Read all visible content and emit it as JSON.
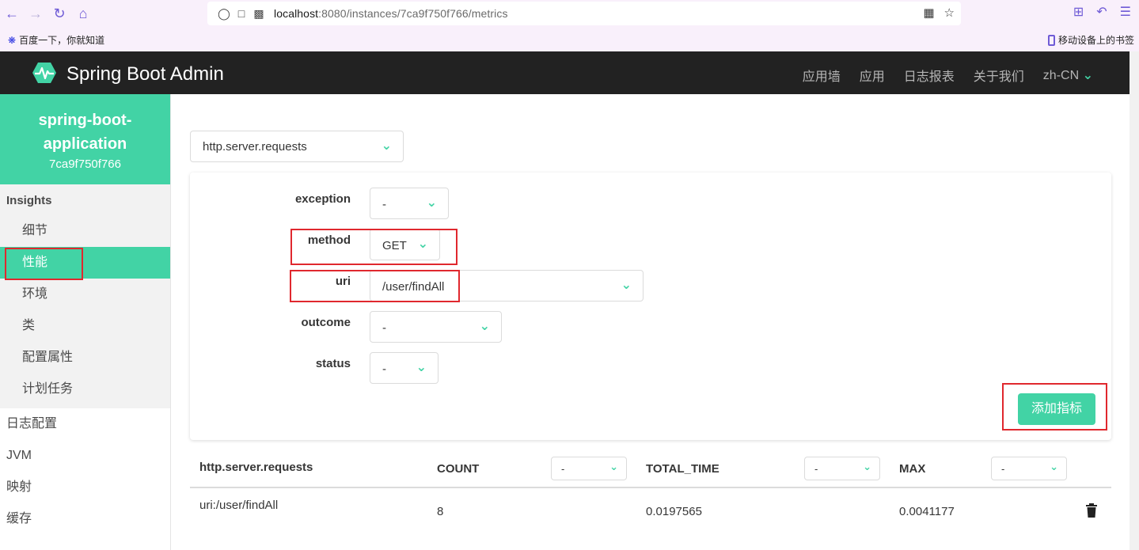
{
  "browser": {
    "url_host": "localhost",
    "url_rest": ":8080/instances/7ca9f750f766/metrics"
  },
  "bookmarks": {
    "left": "百度一下，你就知道",
    "right": "移动设备上的书签"
  },
  "header": {
    "brand": "Spring Boot Admin",
    "nav": [
      "应用墙",
      "应用",
      "日志报表",
      "关于我们"
    ],
    "lang": "zh-CN"
  },
  "sidebar": {
    "instance_name": "spring-boot-application",
    "instance_id": "7ca9f750f766",
    "group_title": "Insights",
    "group_items": [
      "细节",
      "性能",
      "环境",
      "类",
      "配置属性",
      "计划任务"
    ],
    "items": [
      "日志配置",
      "JVM",
      "映射",
      "缓存"
    ]
  },
  "main": {
    "metric": "http.server.requests",
    "tags": [
      {
        "label": "exception",
        "value": "-"
      },
      {
        "label": "method",
        "value": "GET"
      },
      {
        "label": "uri",
        "value": "/user/findAll"
      },
      {
        "label": "outcome",
        "value": "-"
      },
      {
        "label": "status",
        "value": "-"
      }
    ],
    "add_button": "添加指标"
  },
  "table": {
    "title": "http.server.requests",
    "columns": [
      {
        "name": "COUNT",
        "select": "-"
      },
      {
        "name": "TOTAL_TIME",
        "select": "-"
      },
      {
        "name": "MAX",
        "select": "-"
      }
    ],
    "rows": [
      {
        "label": "uri:/user/findAll",
        "count": "8",
        "total_time": "0.0197565",
        "max": "0.0041177"
      }
    ]
  },
  "colors": {
    "primary": "#42d3a5",
    "header": "#222222",
    "highlight": "#e0282e"
  }
}
